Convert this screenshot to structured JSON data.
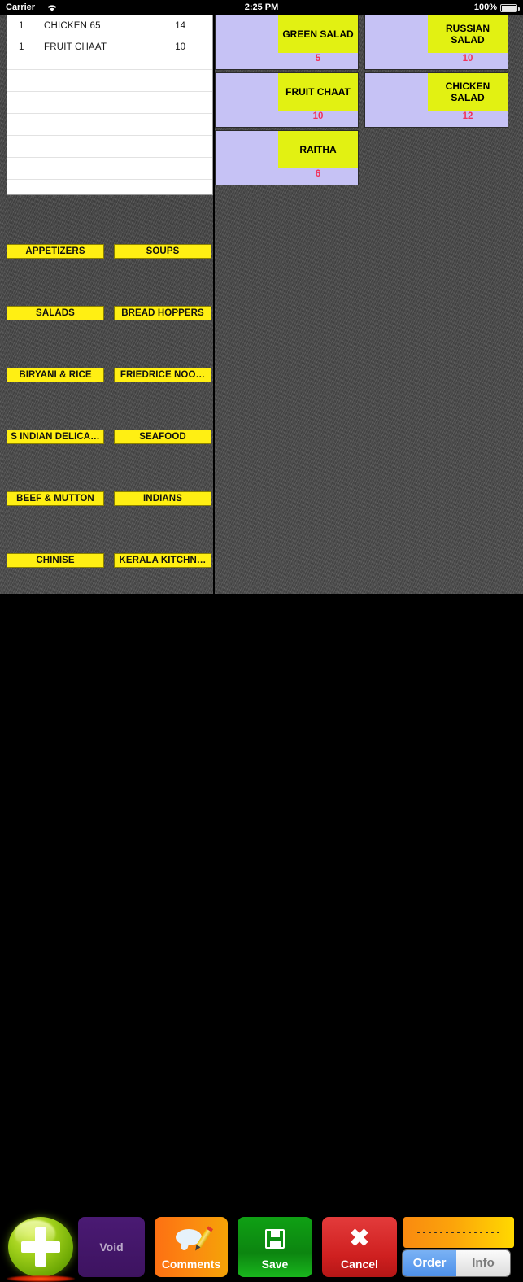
{
  "status_bar": {
    "carrier": "Carrier",
    "wifi_icon": "wifi-icon",
    "time": "2:25 PM",
    "battery_percent": "100%",
    "battery_icon": "battery-full-icon"
  },
  "order_ticket": {
    "rows": [
      {
        "qty": "1",
        "name": "CHICKEN 65",
        "price": "14"
      },
      {
        "qty": "1",
        "name": "FRUIT CHAAT",
        "price": "10"
      }
    ],
    "blank_row_count": 7
  },
  "categories": [
    {
      "label": "APPETIZERS"
    },
    {
      "label": "SOUPS"
    },
    {
      "label": "SALADS"
    },
    {
      "label": "BREAD HOPPERS"
    },
    {
      "label": "BIRYANI & RICE"
    },
    {
      "label": "FRIEDRICE NOO…"
    },
    {
      "label": "S INDIAN DELICA…"
    },
    {
      "label": "SEAFOOD"
    },
    {
      "label": "BEEF & MUTTON"
    },
    {
      "label": "INDIANS"
    },
    {
      "label": "CHINISE"
    },
    {
      "label": "KERALA KITCHN…"
    }
  ],
  "items": [
    {
      "name": "GREEN SALAD",
      "price": "5"
    },
    {
      "name": "RUSSIAN SALAD",
      "price": "10"
    },
    {
      "name": "FRUIT CHAAT",
      "price": "10"
    },
    {
      "name": "CHICKEN SALAD",
      "price": "12"
    },
    {
      "name": "RAITHA",
      "price": "6"
    }
  ],
  "toolbar": {
    "add_icon": "plus-icon",
    "void_label": "Void",
    "comments_label": "Comments",
    "comments_icon": "comment-bubble-pencil-icon",
    "save_label": "Save",
    "save_icon": "floppy-disk-icon",
    "cancel_label": "Cancel",
    "cancel_icon": "x-icon",
    "order_info_display": "---------------",
    "segment_order": "Order",
    "segment_info": "Info"
  },
  "colors": {
    "category_button": "#ffef13",
    "tile_body": "#c6c2f5",
    "tile_label": "#e2f112",
    "tile_price": "#f0335c",
    "background": "#4a4a4a"
  }
}
